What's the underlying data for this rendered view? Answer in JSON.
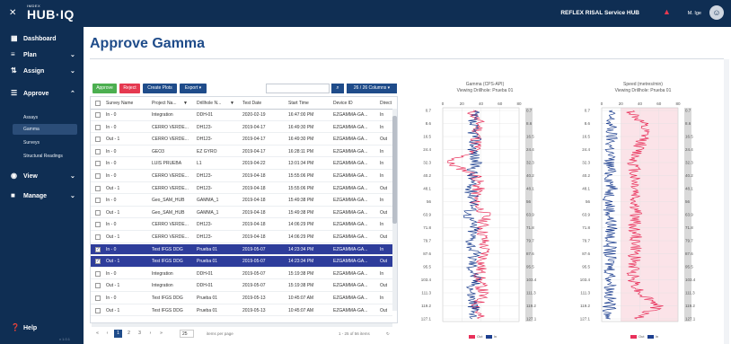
{
  "header": {
    "close_icon": "close-icon",
    "logo_small": "IMDEX",
    "logo_big": "HUB·IQ",
    "brand": "REFLEX RISAL Service HUB",
    "user": "M. Ige",
    "avatar_initial": "☺"
  },
  "sidebar": {
    "items": [
      {
        "label": "Dashboard",
        "icon": "dashboard-icon"
      },
      {
        "label": "Plan",
        "icon": "plan-icon"
      },
      {
        "label": "Assign",
        "icon": "assign-icon"
      },
      {
        "label": "Approve",
        "icon": "approve-icon"
      },
      {
        "label": "View",
        "icon": "view-icon"
      },
      {
        "label": "Manage",
        "icon": "manage-icon"
      },
      {
        "label": "Help",
        "icon": "help-icon"
      }
    ],
    "subitems": [
      "Assays",
      "Gamma",
      "Surveys",
      "Structural Readings"
    ],
    "version": "v 1.0.1"
  },
  "page": {
    "title": "Approve Gamma"
  },
  "toolbar": {
    "approve": "Approve",
    "reject": "Reject",
    "create_plots": "Create Plots",
    "export": "Export ▾",
    "columns": "26 / 26 Columns ▾",
    "search_placeholder": ""
  },
  "table": {
    "columns": [
      "Survey Name",
      "Project Na...",
      "Drillhole N...",
      "Test Date",
      "Start Time",
      "Device ID",
      "Direct"
    ],
    "rows": [
      {
        "sel": false,
        "c": [
          "In - 0",
          "Integration",
          "DDH-01",
          "2020-02-19",
          "16:47:00 PM",
          "EZGAMMA-GA...",
          "In"
        ]
      },
      {
        "sel": false,
        "c": [
          "In - 0",
          "CERRO VERDE...",
          "DH123-",
          "2019-04-17",
          "16:49:30 PM",
          "EZGAMMA-GA...",
          "In"
        ]
      },
      {
        "sel": false,
        "c": [
          "Out - 1",
          "CERRO VERDE...",
          "DH123-",
          "2019-04-17",
          "16:49:30 PM",
          "EZGAMMA-GA...",
          "Out"
        ]
      },
      {
        "sel": false,
        "c": [
          "In - 0",
          "GEO3",
          "EZ GYRO",
          "2019-04-17",
          "16:28:11 PM",
          "EZGAMMA-GA...",
          "In"
        ]
      },
      {
        "sel": false,
        "c": [
          "In - 0",
          "LUIS PRUEBA",
          "L1",
          "2019-04-22",
          "13:01:34 PM",
          "EZGAMMA-GA...",
          "In"
        ]
      },
      {
        "sel": false,
        "c": [
          "In - 0",
          "CERRO VERDE...",
          "DH123-",
          "2019-04-18",
          "15:55:06 PM",
          "EZGAMMA-GA...",
          "In"
        ]
      },
      {
        "sel": false,
        "c": [
          "Out - 1",
          "CERRO VERDE...",
          "DH123-",
          "2019-04-18",
          "15:55:06 PM",
          "EZGAMMA-GA...",
          "Out"
        ]
      },
      {
        "sel": false,
        "c": [
          "In - 0",
          "Geo_SAM_HUB",
          "GAMMA_1",
          "2019-04-18",
          "15:49:38 PM",
          "EZGAMMA-GA...",
          "In"
        ]
      },
      {
        "sel": false,
        "c": [
          "Out - 1",
          "Geo_SAM_HUB",
          "GAMMA_1",
          "2019-04-18",
          "15:49:38 PM",
          "EZGAMMA-GA...",
          "Out"
        ]
      },
      {
        "sel": false,
        "c": [
          "In - 0",
          "CERRO VERDE...",
          "DH123-",
          "2019-04-18",
          "14:06:29 PM",
          "EZGAMMA-GA...",
          "In"
        ]
      },
      {
        "sel": false,
        "c": [
          "Out - 1",
          "CERRO VERDE...",
          "DH123-",
          "2019-04-18",
          "14:06:29 PM",
          "EZGAMMA-GA...",
          "Out"
        ]
      },
      {
        "sel": true,
        "c": [
          "In - 0",
          "Test IFGS DDG",
          "Prueba 01",
          "2019-05-07",
          "14:23:34 PM",
          "EZGAMMA-GA...",
          "In"
        ]
      },
      {
        "sel": true,
        "c": [
          "Out - 1",
          "Test IFGS DDG",
          "Prueba 01",
          "2019-05-07",
          "14:23:34 PM",
          "EZGAMMA-GA...",
          "Out"
        ]
      },
      {
        "sel": false,
        "c": [
          "In - 0",
          "Integration",
          "DDH-01",
          "2019-05-07",
          "15:19:38 PM",
          "EZGAMMA-GA...",
          "In"
        ]
      },
      {
        "sel": false,
        "c": [
          "Out - 1",
          "Integration",
          "DDH-01",
          "2019-05-07",
          "15:19:38 PM",
          "EZGAMMA-GA...",
          "Out"
        ]
      },
      {
        "sel": false,
        "c": [
          "In - 0",
          "Test IFGS DDG",
          "Prueba 01",
          "2019-05-13",
          "10:45:07 AM",
          "EZGAMMA-GA...",
          "In"
        ]
      },
      {
        "sel": false,
        "c": [
          "Out - 1",
          "Test IFGS DDG",
          "Prueba 01",
          "2019-05-13",
          "10:45:07 AM",
          "EZGAMMA-GA...",
          "Out"
        ]
      }
    ]
  },
  "pager": {
    "pages": [
      "«",
      "‹",
      "1",
      "2",
      "3",
      "›",
      "»"
    ],
    "current": "1",
    "page_size": "25",
    "per_page": "items per page",
    "range": "1 - 25 of 56 items"
  },
  "colors": {
    "navy": "#0f2e53",
    "accent": "#1f4c8a",
    "approve": "#4caf50",
    "reject": "#e53950",
    "selected_row": "#2e3d9b",
    "out_series": "#e8305a",
    "in_series": "#1d3f8f"
  },
  "chart_data": [
    {
      "type": "line",
      "title": "Gamma (CPS-API)",
      "subtitle": "Viewing Drillhole: Prueba 01",
      "xlim": [
        0,
        80
      ],
      "x_ticks": [
        "0",
        "20",
        "40",
        "60",
        "80"
      ],
      "y_ticks": [
        "0.7",
        "8.6",
        "16.5",
        "24.4",
        "32.3",
        "40.2",
        "48.1",
        "56",
        "63.9",
        "71.8",
        "79.7",
        "87.6",
        "95.5",
        "103.4",
        "111.3",
        "119.2",
        "127.1"
      ],
      "series": [
        {
          "name": "Out"
        },
        {
          "name": "In"
        }
      ],
      "depths": [
        0.7,
        8.6,
        16.5,
        24.4,
        32.3,
        40.2,
        48.1,
        56,
        63.9,
        71.8,
        79.7,
        87.6,
        95.5,
        103.4,
        111.3,
        119.2,
        127.1
      ],
      "out_values": [
        30,
        38,
        36,
        35,
        5,
        36,
        37,
        33,
        45,
        41,
        43,
        44,
        40,
        38,
        42,
        36,
        38
      ],
      "in_values": [
        32,
        30,
        34,
        33,
        34,
        31,
        28,
        35,
        27,
        33,
        30,
        33,
        31,
        35,
        30,
        33,
        31
      ]
    },
    {
      "type": "line",
      "title": "Speed (metres/min)",
      "subtitle": "Viewing Drillhole: Prueba 01",
      "xlim": [
        0,
        80
      ],
      "x_ticks": [
        "0",
        "20",
        "40",
        "60",
        "80"
      ],
      "y_ticks": [
        "0.7",
        "8.6",
        "16.5",
        "24.4",
        "32.3",
        "40.2",
        "48.1",
        "56",
        "63.9",
        "71.8",
        "79.7",
        "87.6",
        "95.5",
        "103.4",
        "111.3",
        "119.2",
        "127.1"
      ],
      "series": [
        {
          "name": "Out"
        },
        {
          "name": "In"
        }
      ],
      "depths": [
        0.7,
        8.6,
        16.5,
        24.4,
        32.3,
        40.2,
        48.1,
        56,
        63.9,
        71.8,
        79.7,
        87.6,
        95.5,
        103.4,
        111.3,
        119.2,
        127.1
      ],
      "out_values": [
        30,
        42,
        45,
        38,
        34,
        35,
        36,
        35,
        36,
        34,
        36,
        35,
        33,
        34,
        40,
        60,
        37
      ],
      "in_values": [
        8,
        9,
        10,
        9,
        8,
        9,
        10,
        8,
        9,
        10,
        9,
        8,
        9,
        10,
        9,
        8,
        9
      ]
    }
  ]
}
